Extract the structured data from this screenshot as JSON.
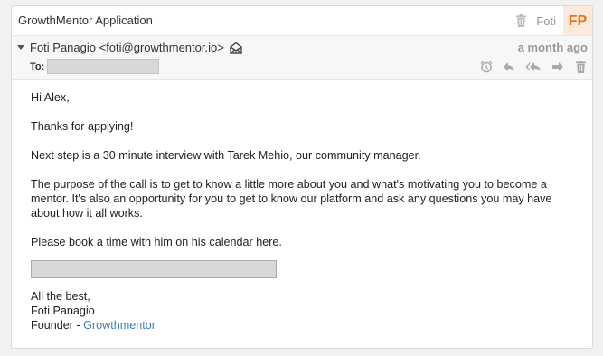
{
  "subject": "GrowthMentor Application",
  "sender_short": "Foti",
  "avatar_initials": "FP",
  "from": "Foti Panagio <foti@growthmentor.io>",
  "date": "a month ago",
  "to_label": "To:",
  "icons": {
    "trash": "trash-icon",
    "envelope": "envelope-open-icon",
    "snooze": "alarm-clock-icon",
    "reply": "reply-icon",
    "reply_all": "reply-all-icon",
    "forward": "forward-icon",
    "delete": "trash-icon"
  },
  "colors": {
    "avatar_text": "#e8731a",
    "avatar_bg": "#fde9dc",
    "link": "#3b7bbf"
  },
  "body": {
    "greeting": "Hi Alex,",
    "p1": "Thanks for applying!",
    "p2": "Next step is a 30 minute interview with Tarek Mehio, our community manager.",
    "p3": "The purpose of the call is to get to know a little more about you and what's motivating you to become a mentor. It's also an opportunity for you to get to know our platform and ask any questions you may have about how it all works.",
    "p4": "Please book a time with him on his calendar here.",
    "closing": "All the best,",
    "sig_name": "Foti Panagio",
    "sig_title_prefix": "Founder - ",
    "sig_company": "Growthmentor"
  }
}
